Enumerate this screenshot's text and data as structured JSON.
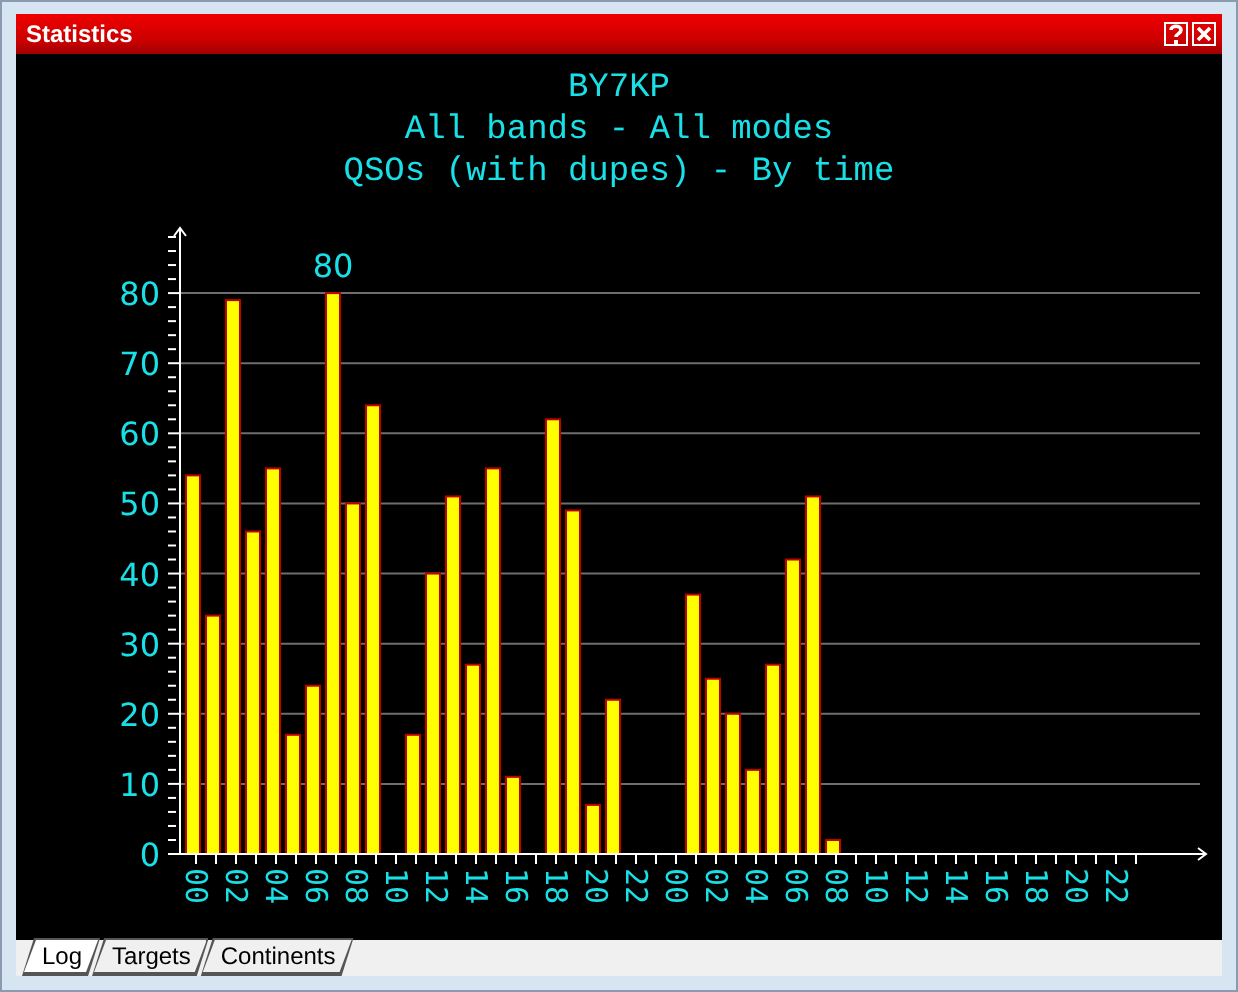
{
  "window": {
    "title": "Statistics"
  },
  "header": [
    "BY7KP",
    "All bands - All modes",
    "QSOs (with dupes) - By time"
  ],
  "chart_data": {
    "type": "bar",
    "x": [
      0,
      1,
      2,
      3,
      4,
      5,
      6,
      7,
      8,
      9,
      10,
      11,
      12,
      13,
      14,
      15,
      16,
      17,
      18,
      19,
      20,
      21,
      22,
      23,
      24,
      25,
      26,
      27,
      28,
      29,
      30,
      31,
      32,
      33,
      34,
      35,
      36,
      37,
      38,
      39,
      40,
      41,
      42,
      43,
      44,
      45,
      46,
      47
    ],
    "values": [
      54,
      34,
      79,
      46,
      55,
      17,
      24,
      80,
      50,
      64,
      0,
      17,
      40,
      51,
      27,
      55,
      11,
      0,
      62,
      49,
      7,
      22,
      0,
      0,
      0,
      37,
      25,
      20,
      12,
      27,
      42,
      51,
      2,
      0,
      0,
      0,
      0,
      0,
      0,
      0,
      0,
      0,
      0,
      0,
      0,
      0,
      0,
      0
    ],
    "xlim": [
      -0.65,
      50.65
    ],
    "ylim": [
      0,
      89
    ],
    "grid": true,
    "yticks": [
      0,
      10,
      20,
      30,
      40,
      50,
      60,
      70,
      80
    ],
    "xticks": [
      {
        "value": 0,
        "label": "00"
      },
      {
        "value": 2,
        "label": "02"
      },
      {
        "value": 4,
        "label": "04"
      },
      {
        "value": 6,
        "label": "06"
      },
      {
        "value": 8,
        "label": "08"
      },
      {
        "value": 10,
        "label": "10"
      },
      {
        "value": 12,
        "label": "12"
      },
      {
        "value": 14,
        "label": "14"
      },
      {
        "value": 16,
        "label": "16"
      },
      {
        "value": 18,
        "label": "18"
      },
      {
        "value": 20,
        "label": "20"
      },
      {
        "value": 22,
        "label": "22"
      },
      {
        "value": 24,
        "label": "00"
      },
      {
        "value": 26,
        "label": "02"
      },
      {
        "value": 28,
        "label": "04"
      },
      {
        "value": 30,
        "label": "06"
      },
      {
        "value": 32,
        "label": "08"
      },
      {
        "value": 34,
        "label": "10"
      },
      {
        "value": 36,
        "label": "12"
      },
      {
        "value": 38,
        "label": "14"
      },
      {
        "value": 40,
        "label": "16"
      },
      {
        "value": 42,
        "label": "18"
      },
      {
        "value": 44,
        "label": "20"
      },
      {
        "value": 46,
        "label": "22"
      }
    ],
    "annotations": [
      "80"
    ]
  },
  "tabs": [
    {
      "label": "Log",
      "selected": true
    },
    {
      "label": "Targets",
      "selected": false
    },
    {
      "label": "Continents",
      "selected": false
    }
  ]
}
